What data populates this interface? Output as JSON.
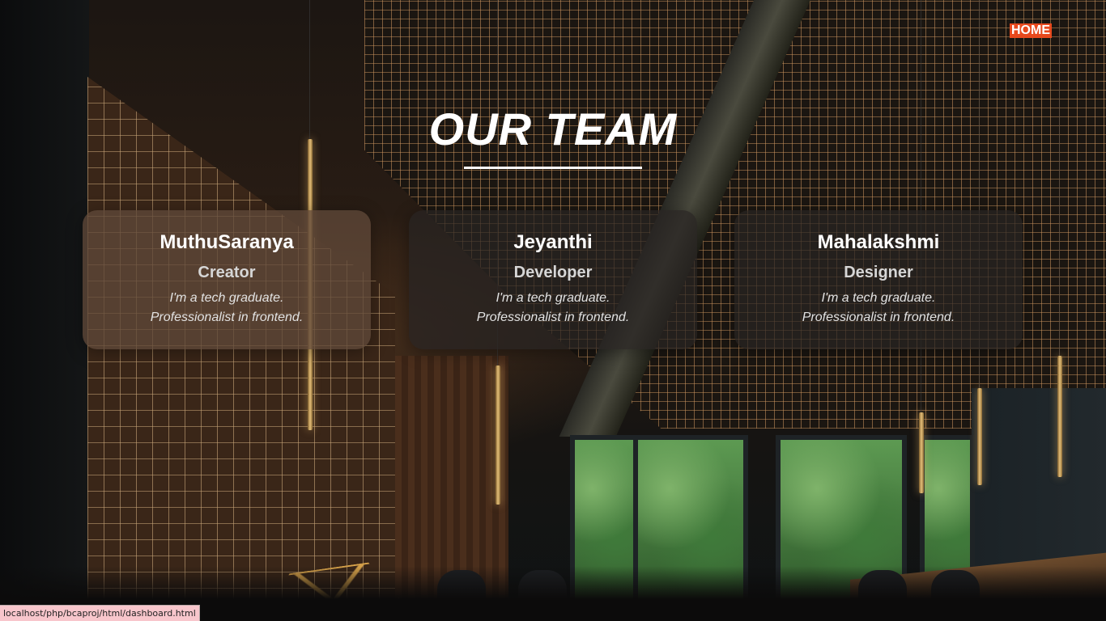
{
  "nav": {
    "home_label": "HOME"
  },
  "page": {
    "title": "OUR TEAM"
  },
  "team": [
    {
      "name": "MuthuSaranya",
      "role": "Creator",
      "desc_line1": "I'm a tech graduate.",
      "desc_line2": "Professionalist in frontend."
    },
    {
      "name": "Jeyanthi",
      "role": "Developer",
      "desc_line1": "I'm a tech graduate.",
      "desc_line2": "Professionalist in frontend."
    },
    {
      "name": "Mahalakshmi",
      "role": "Designer",
      "desc_line1": "I'm a tech graduate.",
      "desc_line2": "Professionalist in frontend."
    }
  ],
  "status_bar": {
    "url": "localhost/php/bcaproj/html/dashboard.html"
  },
  "colors": {
    "home_button_bg": "#e8491d",
    "title_text": "#ffffff",
    "card_bg": "#2a2522"
  },
  "icons": []
}
